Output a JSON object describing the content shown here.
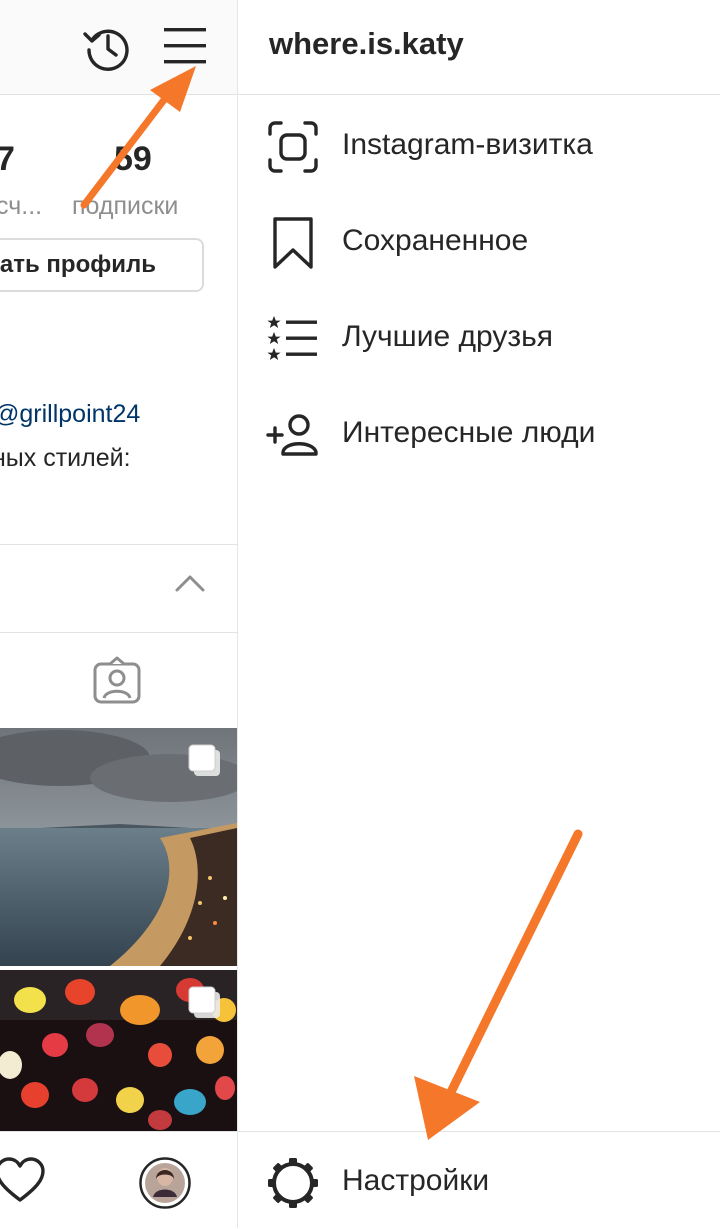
{
  "profile": {
    "stats": [
      {
        "number": "7",
        "label": "сч..."
      },
      {
        "number": "59",
        "label": "подписки"
      }
    ],
    "edit_button": "ать профиль",
    "bio_mention": "@grillpoint24",
    "bio_text": "ных стилей:"
  },
  "drawer": {
    "username": "where.is.katy",
    "items": [
      {
        "label": "Instagram-визитка",
        "icon": "nametag-icon"
      },
      {
        "label": "Сохраненное",
        "icon": "bookmark-icon"
      },
      {
        "label": "Лучшие друзья",
        "icon": "close-friends-icon"
      },
      {
        "label": "Интересные люди",
        "icon": "add-person-icon"
      }
    ],
    "settings": {
      "label": "Настройки",
      "icon": "gear-icon"
    }
  },
  "colors": {
    "accent_arrow": "#f5782a",
    "link": "#003569",
    "muted": "#8e8e8e",
    "text": "#262626"
  }
}
